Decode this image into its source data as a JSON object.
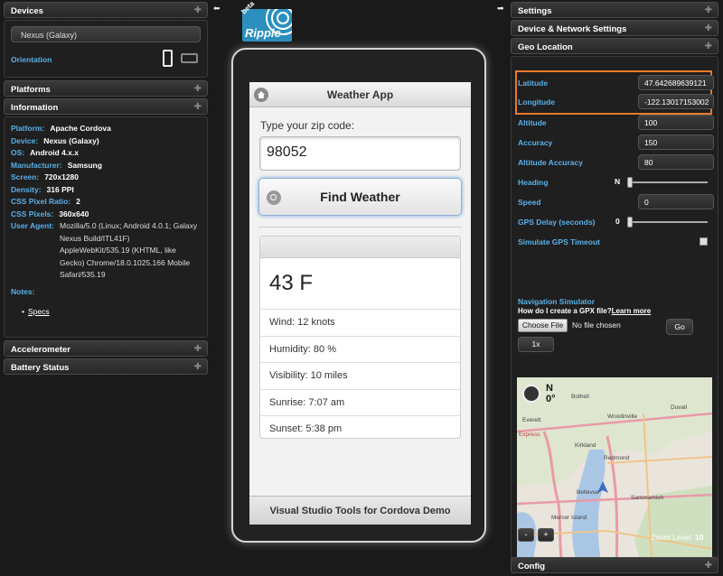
{
  "left": {
    "devices": {
      "title": "Devices",
      "device_value": "Nexus (Galaxy)",
      "orientation_label": "Orientation"
    },
    "platforms": {
      "title": "Platforms"
    },
    "information": {
      "title": "Information",
      "rows": [
        {
          "k": "Platform:",
          "v": "Apache Cordova"
        },
        {
          "k": "Device:",
          "v": "Nexus (Galaxy)"
        },
        {
          "k": "OS:",
          "v": "Android 4.x.x"
        },
        {
          "k": "Manufacturer:",
          "v": "Samsung"
        },
        {
          "k": "Screen:",
          "v": "720x1280"
        },
        {
          "k": "Density:",
          "v": "316 PPI"
        },
        {
          "k": "CSS Pixel Ratio:",
          "v": "2"
        },
        {
          "k": "CSS Pixels:",
          "v": "360x640"
        }
      ],
      "user_agent_label": "User Agent:",
      "user_agent_value": "Mozilla/5.0 (Linux; Android 4.0.1; Galaxy Nexus Build/ITL41F) AppleWebKit/535.19 (KHTML, like Gecko) Chrome/18.0.1025.166 Mobile Safari/535.19",
      "notes_label": "Notes:",
      "specs_link": "Specs"
    },
    "accelerometer": {
      "title": "Accelerometer"
    },
    "battery": {
      "title": "Battery Status"
    }
  },
  "logo": {
    "beta": "beta",
    "name": "Ripple"
  },
  "app": {
    "title": "Weather App",
    "zip_label": "Type your zip code:",
    "zip_value": "98052",
    "button": "Find Weather",
    "temperature": "43 F",
    "details": [
      "Wind: 12 knots",
      "Humidity: 80 %",
      "Visibility: 10 miles",
      "Sunrise: 7:07 am",
      "Sunset: 5:38 pm"
    ],
    "footer": "Visual Studio Tools for Cordova Demo"
  },
  "right": {
    "settings": {
      "title": "Settings"
    },
    "network": {
      "title": "Device & Network Settings"
    },
    "geo": {
      "title": "Geo Location",
      "latitude_label": "Latitude",
      "latitude_value": "47.642689639121",
      "longitude_label": "Longitude",
      "longitude_value": "-122.13017153002",
      "altitude_label": "Altitude",
      "altitude_value": "100",
      "accuracy_label": "Accuracy",
      "accuracy_value": "150",
      "alt_accuracy_label": "Altitude Accuracy",
      "alt_accuracy_value": "80",
      "heading_label": "Heading",
      "heading_value": "N",
      "speed_label": "Speed",
      "speed_value": "0",
      "gps_delay_label": "GPS Delay (seconds)",
      "gps_delay_value": "0",
      "timeout_label": "Simulate GPS Timeout",
      "nav_label": "Navigation Simulator",
      "gpx_question": "How do I create a GPX file?",
      "learn_more": "Learn more",
      "choose_file": "Choose File",
      "no_file": "No file chosen",
      "go": "Go",
      "speed_multiplier": "1x",
      "map": {
        "heading_letter": "N",
        "heading_degrees": "0°",
        "places": [
          "Duvall",
          "Kirkland",
          "Redmond",
          "Bellevue",
          "Sammamish",
          "Mercer Island",
          "Bothell",
          "Everett",
          "Woodinville",
          "Express"
        ]
      },
      "zoom_minus": "-",
      "zoom_plus": "+",
      "zoom_label": "Zoom Level:",
      "zoom_value": "10"
    },
    "config": {
      "title": "Config"
    }
  },
  "colors": {
    "highlight": "#e8792a",
    "accent_label": "#5ab0e8",
    "logo_bg": "#2b8fbd"
  }
}
